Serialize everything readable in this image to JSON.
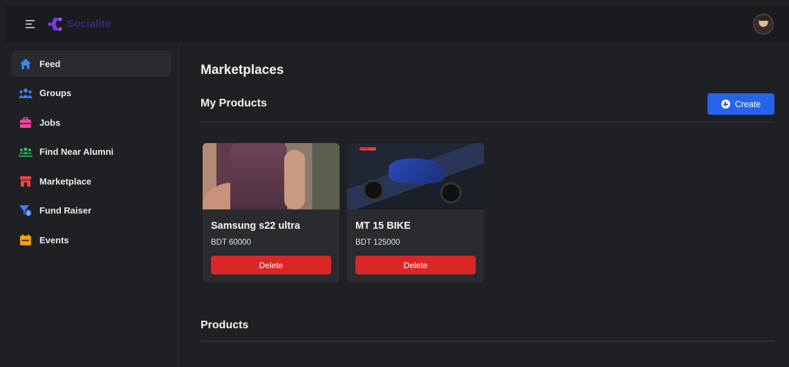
{
  "app": {
    "name": "Socialite"
  },
  "colors": {
    "accent": "#2563eb",
    "danger": "#dc2626",
    "logo": "#7c3aed"
  },
  "sidebar": {
    "items": [
      {
        "label": "Feed",
        "icon": "home-icon",
        "active": true
      },
      {
        "label": "Groups",
        "icon": "people-icon"
      },
      {
        "label": "Jobs",
        "icon": "briefcase-icon"
      },
      {
        "label": "Find Near Alumni",
        "icon": "users-group-icon"
      },
      {
        "label": "Marketplace",
        "icon": "store-icon"
      },
      {
        "label": "Fund Raiser",
        "icon": "fund-icon"
      },
      {
        "label": "Events",
        "icon": "calendar-icon"
      }
    ]
  },
  "main": {
    "title": "Marketplaces",
    "my_products": {
      "title": "My Products",
      "create_label": "Create",
      "items": [
        {
          "name": "Samsung s22 ultra",
          "price": "BDT 60000",
          "delete_label": "Delete",
          "image": "phone-photo"
        },
        {
          "name": "MT 15 BIKE",
          "price": "BDT 125000",
          "delete_label": "Delete",
          "image": "motorbike-photo"
        }
      ]
    },
    "products": {
      "title": "Products"
    }
  }
}
